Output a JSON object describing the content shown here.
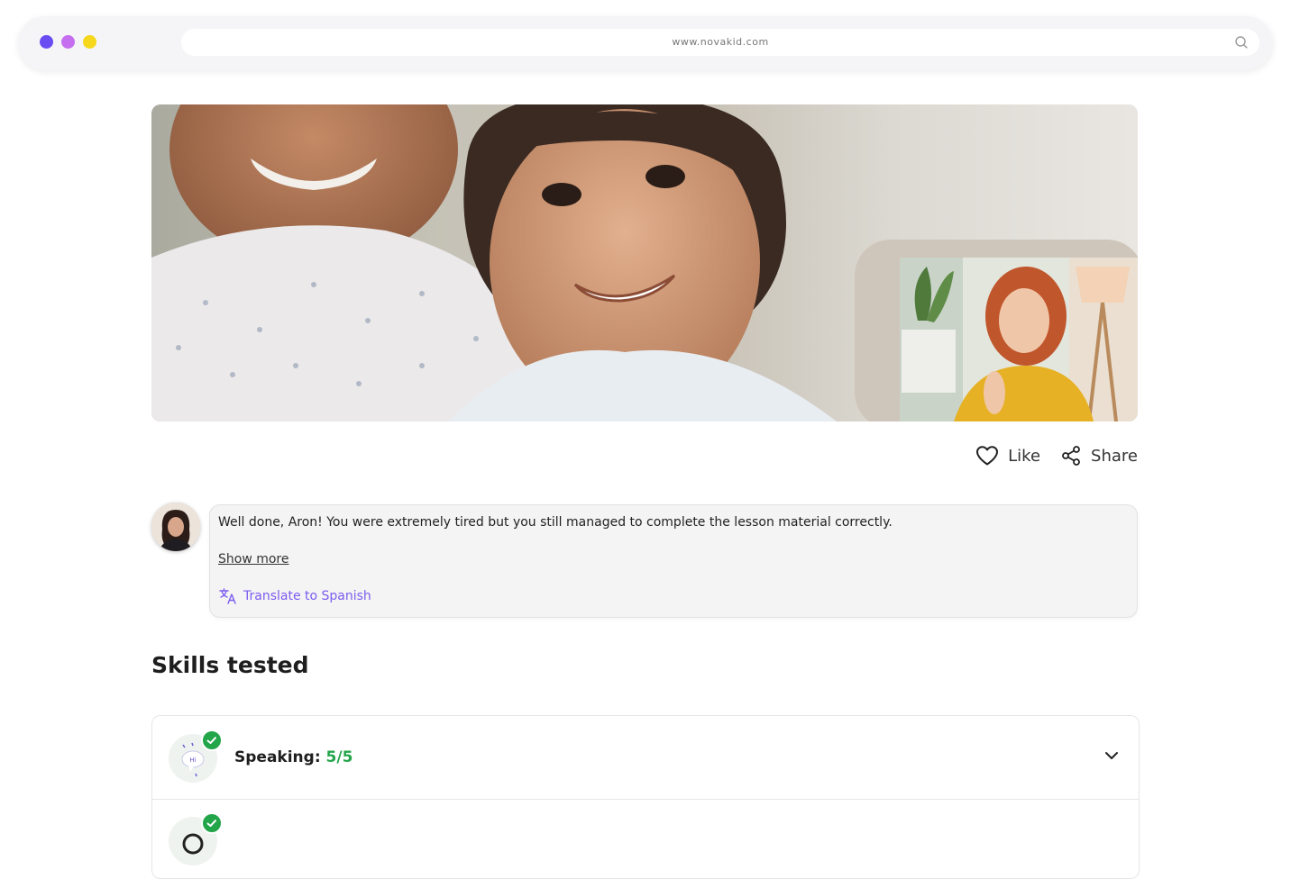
{
  "browser": {
    "url": "www.novakid.com",
    "dot_colors": [
      "#6a4df2",
      "#c56ef0",
      "#f5d81b"
    ]
  },
  "actions": {
    "like_label": "Like",
    "share_label": "Share"
  },
  "comment": {
    "text": "Well done, Aron! You were extremely tired but you still managed to complete the lesson material correctly.",
    "show_more_label": "Show more",
    "translate_label": "Translate to Spanish"
  },
  "skills": {
    "title": "Skills tested",
    "items": [
      {
        "name": "Speaking:",
        "score": "5/5",
        "icon": "speech-bubble-hi-icon"
      }
    ]
  },
  "colors": {
    "accent_purple": "#7b5cf0",
    "success_green": "#23a54a"
  }
}
